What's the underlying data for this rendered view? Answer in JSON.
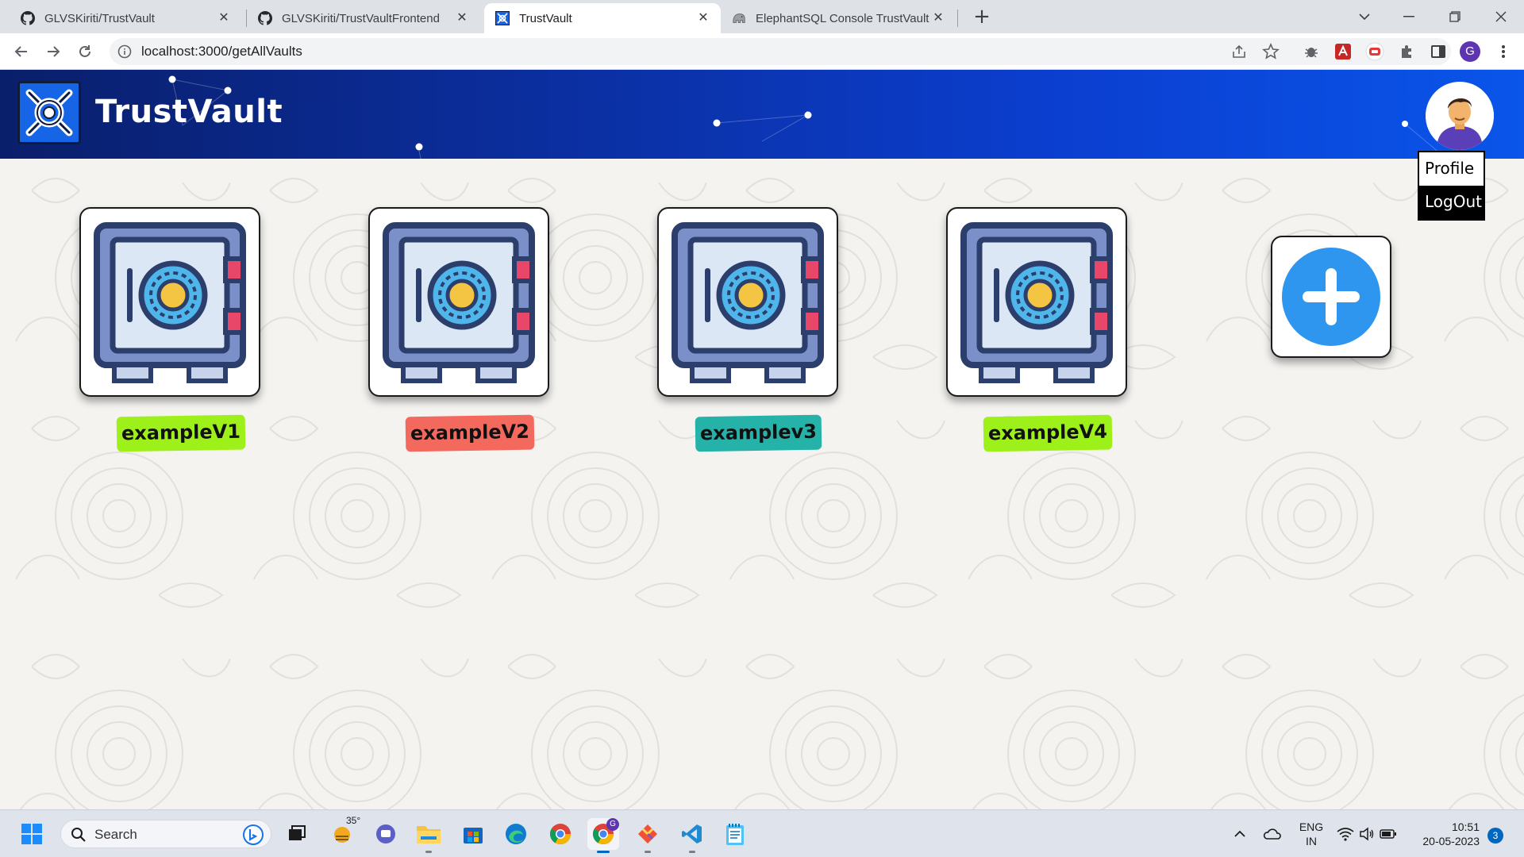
{
  "browser": {
    "tabs": [
      {
        "title": "GLVSKiriti/TrustVault",
        "icon": "github-icon",
        "active": false
      },
      {
        "title": "GLVSKiriti/TrustVaultFrontend",
        "icon": "github-icon",
        "active": false
      },
      {
        "title": "TrustVault",
        "icon": "trustvault-icon",
        "active": true
      },
      {
        "title": "ElephantSQL Console TrustVault",
        "icon": "elephant-icon",
        "active": false
      }
    ],
    "url": "localhost:3000/getAllVaults",
    "profile_initial": "G"
  },
  "app": {
    "brand": "TrustVault",
    "profile_menu": {
      "profile": "Profile",
      "logout": "LogOut"
    },
    "vaults": [
      {
        "name": "exampleV1",
        "color": "#9ef01a"
      },
      {
        "name": "exampleV2",
        "color": "#f4695e"
      },
      {
        "name": "examplev3",
        "color": "#25b2a8"
      },
      {
        "name": "exampleV4",
        "color": "#9ef01a"
      }
    ],
    "add_vault_icon": "plus-icon"
  },
  "taskbar": {
    "search_label": "Search",
    "weather": "35°",
    "chrome_badge": "G",
    "lang_line1": "ENG",
    "lang_line2": "IN",
    "time": "10:51",
    "date": "20-05-2023",
    "notifications": "3"
  }
}
